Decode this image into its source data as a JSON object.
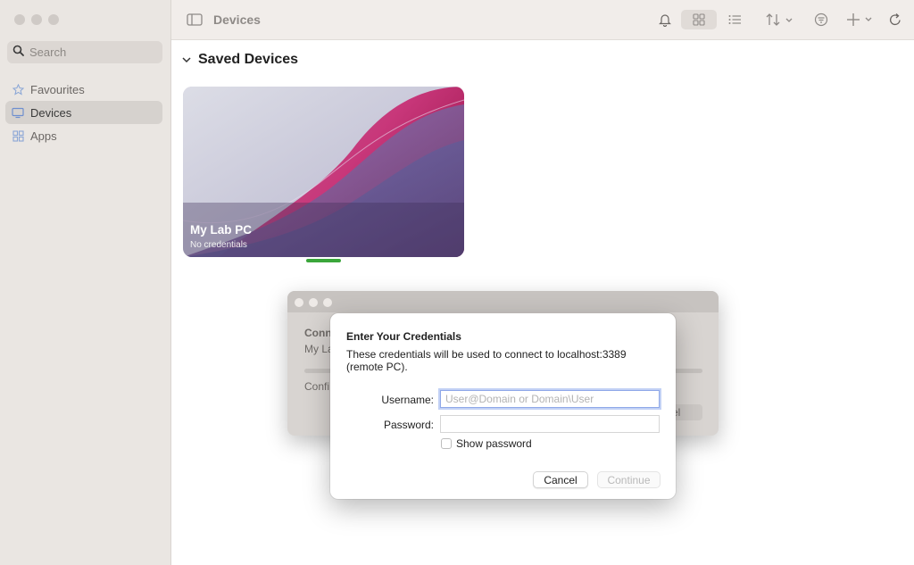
{
  "sidebar": {
    "search_placeholder": "Search",
    "items": [
      {
        "label": "Favourites",
        "icon": "star-icon",
        "active": false
      },
      {
        "label": "Devices",
        "icon": "monitor-icon",
        "active": true
      },
      {
        "label": "Apps",
        "icon": "apps-grid-icon",
        "active": false
      }
    ]
  },
  "toolbar": {
    "title": "Devices",
    "icons": [
      "sidebar-toggle-icon",
      "bell-icon",
      "grid-view-icon",
      "list-view-icon",
      "sort-icon",
      "filter-icon",
      "add-icon",
      "refresh-icon"
    ]
  },
  "main": {
    "section_title": "Saved Devices",
    "device": {
      "name": "My Lab PC",
      "subtitle": "No credentials"
    }
  },
  "background_dialog": {
    "heading": "Conn",
    "line1": "My La",
    "line2": "Confi",
    "cancel_partial": "cel"
  },
  "credentials_dialog": {
    "title": "Enter Your Credentials",
    "description": "These credentials will be used to connect to localhost:3389 (remote PC).",
    "username_label": "Username:",
    "username_placeholder": "User@Domain or Domain\\User",
    "password_label": "Password:",
    "show_password_label": "Show password",
    "cancel_label": "Cancel",
    "continue_label": "Continue"
  },
  "colors": {
    "sidebar_bg": "#eae6e2",
    "status_green": "#3aa63a",
    "focus_ring": "#8fa8e8"
  }
}
